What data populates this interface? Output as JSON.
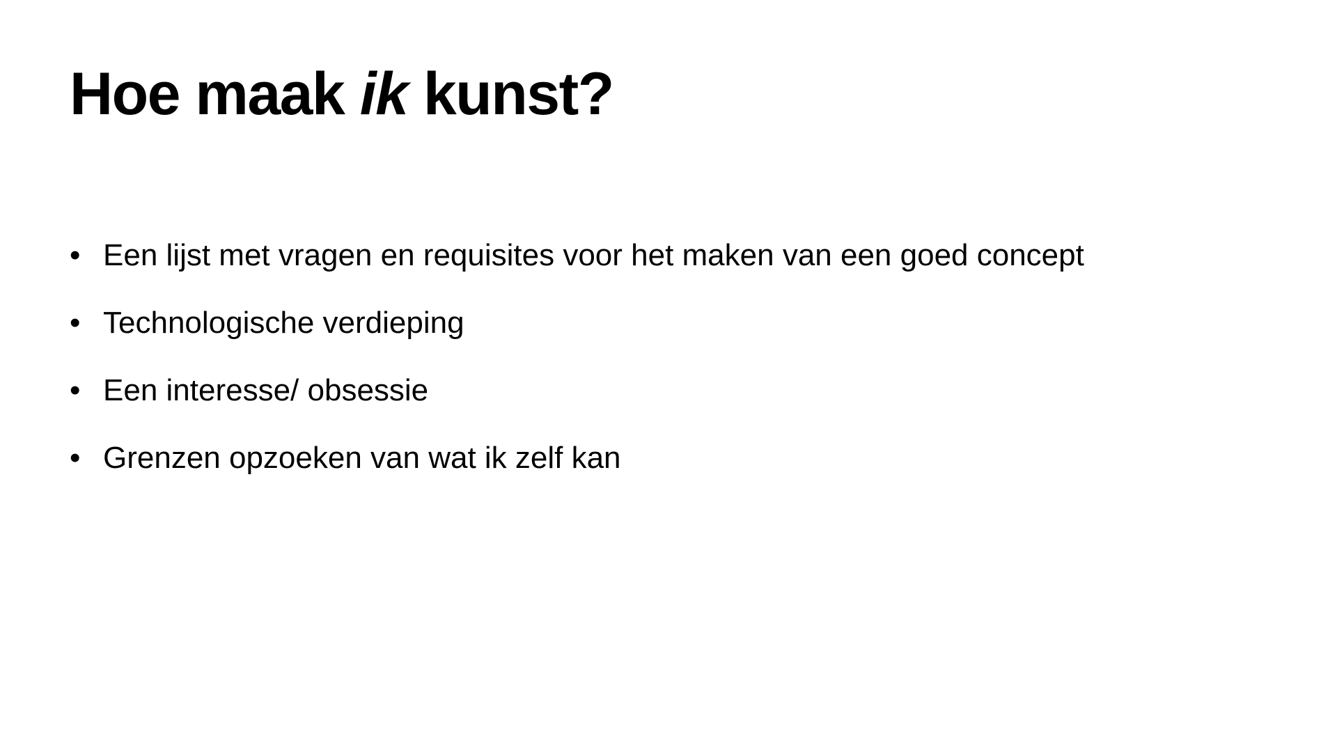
{
  "slide": {
    "title": {
      "part1": "Hoe maak ",
      "emphasis": "ik",
      "part2": " kunst?"
    },
    "bullet_glyph": "•",
    "bullets": [
      "Een lijst met vragen en requisites voor het maken van een goed concept",
      "Technologische verdieping",
      "Een interesse/ obsessie",
      "Grenzen opzoeken van wat ik zelf kan"
    ]
  }
}
